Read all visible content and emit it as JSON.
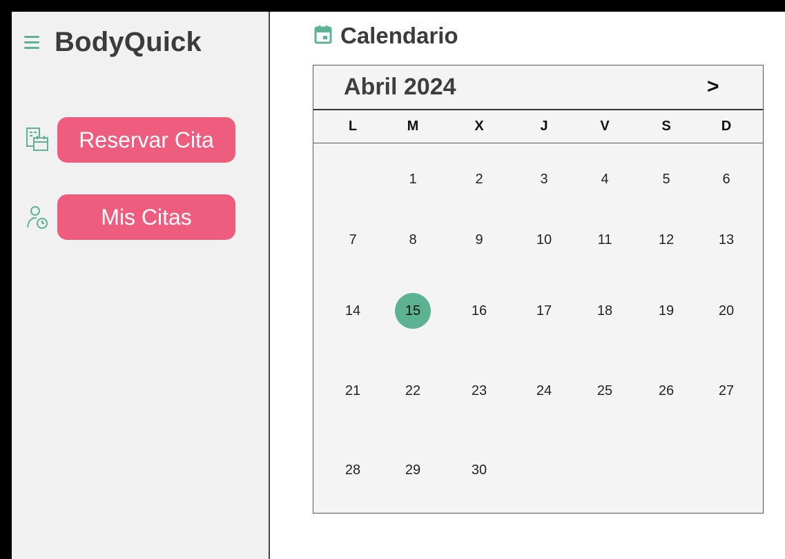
{
  "sidebar": {
    "brand": "BodyQuick",
    "items": [
      {
        "label": "Reservar Cita",
        "icon": "booking-icon"
      },
      {
        "label": "Mis Citas",
        "icon": "user-clock-icon"
      }
    ]
  },
  "main": {
    "title": "Calendario",
    "title_icon": "calendar-icon"
  },
  "calendar": {
    "month": "Abril 2024",
    "next_label": ">",
    "weekdays": [
      "L",
      "M",
      "X",
      "J",
      "V",
      "S",
      "D"
    ],
    "days": [
      "1",
      "2",
      "3",
      "4",
      "5",
      "6",
      "7",
      "8",
      "9",
      "10",
      "11",
      "12",
      "13",
      "14",
      "15",
      "16",
      "17",
      "18",
      "19",
      "20",
      "21",
      "22",
      "23",
      "24",
      "25",
      "26",
      "27",
      "28",
      "29",
      "30"
    ],
    "selected_day": "15",
    "first_weekday_index": 1
  },
  "colors": {
    "accent_green": "#5cb394",
    "button_pink": "#ee5c7e",
    "sidebar_bg": "#f1f1f1",
    "calendar_bg": "#f4f4f4"
  }
}
